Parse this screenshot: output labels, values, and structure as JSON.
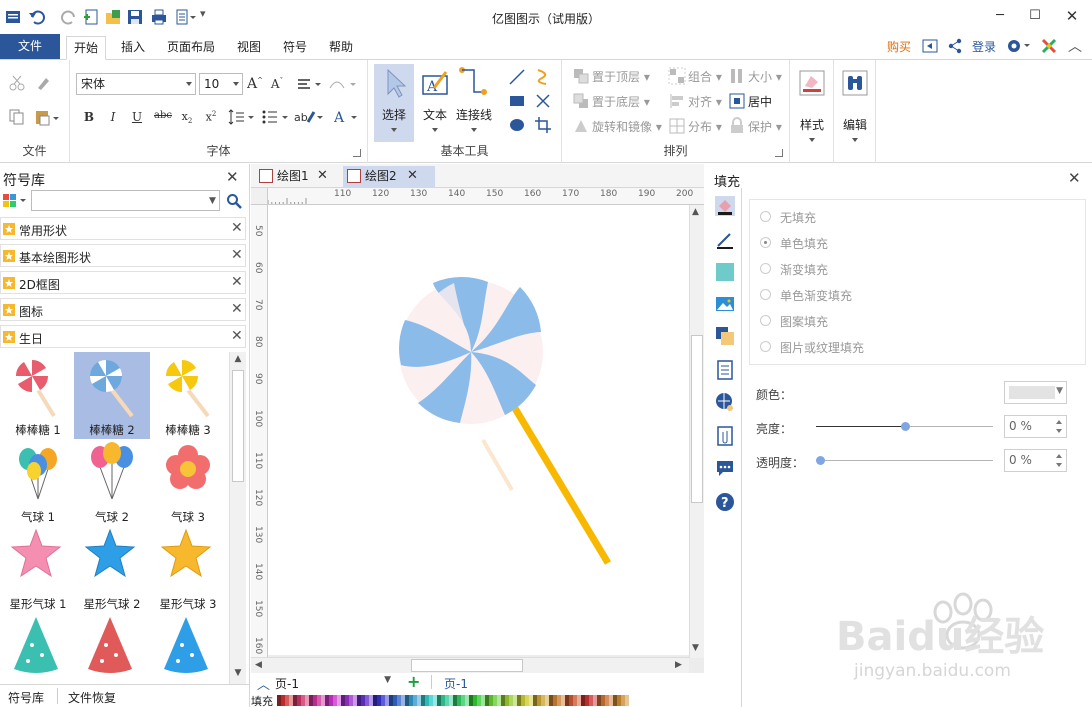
{
  "titlebar": {
    "title": "亿图图示（试用版）",
    "quick_access": [
      "app-icon",
      "undo-icon",
      "redo-icon",
      "new-icon",
      "open-icon",
      "save-icon",
      "print-icon",
      "page-setup-icon"
    ]
  },
  "menu": {
    "file": "文件",
    "tabs": [
      "开始",
      "插入",
      "页面布局",
      "视图",
      "符号",
      "帮助"
    ],
    "buy": "购买",
    "login": "登录"
  },
  "ribbon": {
    "file_group": "文件",
    "font_group": "字体",
    "font_name": "宋体",
    "font_size": "10",
    "tools_group": "基本工具",
    "tools": [
      "选择",
      "文本",
      "连接线"
    ],
    "arrange_group": "排列",
    "arrange": {
      "bring_front": "置于顶层",
      "send_back": "置于底层",
      "rotate": "旋转和镜像",
      "group": "组合",
      "align": "对齐",
      "distribute": "分布",
      "size": "大小",
      "center": "居中",
      "protect": "保护"
    },
    "style": "样式",
    "edit": "编辑"
  },
  "library": {
    "title": "符号库",
    "search_placeholder": "",
    "categories": [
      "常用形状",
      "基本绘图形状",
      "2D框图",
      "图标",
      "生日"
    ],
    "shapes": [
      "棒棒糖 1",
      "棒棒糖 2",
      "棒棒糖 3",
      "气球 1",
      "气球 2",
      "气球 3",
      "星形气球 1",
      "星形气球 2",
      "星形气球 3"
    ],
    "bottom_tabs": [
      "符号库",
      "文件恢复"
    ]
  },
  "doc_tabs": [
    "绘图1",
    "绘图2"
  ],
  "page_bar": {
    "page_select": "页-1",
    "page_tab": "页-1"
  },
  "fill_bar_label": "填充",
  "fill_panel": {
    "title": "填充",
    "options": [
      "无填充",
      "单色填充",
      "渐变填充",
      "单色渐变填充",
      "图案填充",
      "图片或纹理填充"
    ],
    "selected_option": "单色填充",
    "color_label": "颜色：",
    "brightness_label": "亮度：",
    "brightness_value": "0 %",
    "transparency_label": "透明度：",
    "transparency_value": "0 %",
    "brightness_level": 0.5,
    "transparency_level": 0
  },
  "colors": {
    "accent": "#2b579a",
    "lollipop_blue": "#8bbbe8",
    "lollipop_pink": "#fbeff0",
    "stick_yellow": "#f8b800",
    "buy_orange": "#e36c09"
  },
  "watermark": {
    "brand": "Baidu经验",
    "url": "jingyan.baidu.com"
  }
}
